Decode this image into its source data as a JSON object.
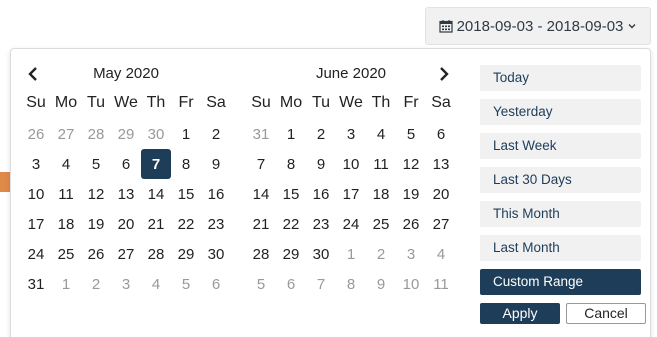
{
  "colors": {
    "accent": "#1e3d59",
    "muted_text": "#999999",
    "range_bg": "#f1f1f1",
    "side_tab": "#e08a4a"
  },
  "trigger": {
    "icon": "calendar-icon",
    "value": "2018-09-03 - 2018-09-03",
    "dropdown_icon": "chevron-down-icon"
  },
  "calendars": [
    {
      "month": "May 2020",
      "weekdays": [
        "Su",
        "Mo",
        "Tu",
        "We",
        "Th",
        "Fr",
        "Sa"
      ],
      "weeks": [
        [
          {
            "d": "26",
            "off": true
          },
          {
            "d": "27",
            "off": true
          },
          {
            "d": "28",
            "off": true
          },
          {
            "d": "29",
            "off": true
          },
          {
            "d": "30",
            "off": true
          },
          {
            "d": "1"
          },
          {
            "d": "2"
          }
        ],
        [
          {
            "d": "3"
          },
          {
            "d": "4"
          },
          {
            "d": "5"
          },
          {
            "d": "6"
          },
          {
            "d": "7",
            "active": true
          },
          {
            "d": "8"
          },
          {
            "d": "9"
          }
        ],
        [
          {
            "d": "10"
          },
          {
            "d": "11"
          },
          {
            "d": "12"
          },
          {
            "d": "13"
          },
          {
            "d": "14"
          },
          {
            "d": "15"
          },
          {
            "d": "16"
          }
        ],
        [
          {
            "d": "17"
          },
          {
            "d": "18"
          },
          {
            "d": "19"
          },
          {
            "d": "20"
          },
          {
            "d": "21"
          },
          {
            "d": "22"
          },
          {
            "d": "23"
          }
        ],
        [
          {
            "d": "24"
          },
          {
            "d": "25"
          },
          {
            "d": "26"
          },
          {
            "d": "27"
          },
          {
            "d": "28"
          },
          {
            "d": "29"
          },
          {
            "d": "30"
          }
        ],
        [
          {
            "d": "31"
          },
          {
            "d": "1",
            "off": true
          },
          {
            "d": "2",
            "off": true
          },
          {
            "d": "3",
            "off": true
          },
          {
            "d": "4",
            "off": true
          },
          {
            "d": "5",
            "off": true
          },
          {
            "d": "6",
            "off": true
          }
        ]
      ]
    },
    {
      "month": "June 2020",
      "weekdays": [
        "Su",
        "Mo",
        "Tu",
        "We",
        "Th",
        "Fr",
        "Sa"
      ],
      "weeks": [
        [
          {
            "d": "31",
            "off": true
          },
          {
            "d": "1"
          },
          {
            "d": "2"
          },
          {
            "d": "3"
          },
          {
            "d": "4"
          },
          {
            "d": "5"
          },
          {
            "d": "6"
          }
        ],
        [
          {
            "d": "7"
          },
          {
            "d": "8"
          },
          {
            "d": "9"
          },
          {
            "d": "10"
          },
          {
            "d": "11"
          },
          {
            "d": "12"
          },
          {
            "d": "13"
          }
        ],
        [
          {
            "d": "14"
          },
          {
            "d": "15"
          },
          {
            "d": "16"
          },
          {
            "d": "17"
          },
          {
            "d": "18"
          },
          {
            "d": "19"
          },
          {
            "d": "20"
          }
        ],
        [
          {
            "d": "21"
          },
          {
            "d": "22"
          },
          {
            "d": "23"
          },
          {
            "d": "24"
          },
          {
            "d": "25"
          },
          {
            "d": "26"
          },
          {
            "d": "27"
          }
        ],
        [
          {
            "d": "28"
          },
          {
            "d": "29"
          },
          {
            "d": "30"
          },
          {
            "d": "1",
            "off": true
          },
          {
            "d": "2",
            "off": true
          },
          {
            "d": "3",
            "off": true
          },
          {
            "d": "4",
            "off": true
          }
        ],
        [
          {
            "d": "5",
            "off": true
          },
          {
            "d": "6",
            "off": true
          },
          {
            "d": "7",
            "off": true
          },
          {
            "d": "8",
            "off": true
          },
          {
            "d": "9",
            "off": true
          },
          {
            "d": "10",
            "off": true
          },
          {
            "d": "11",
            "off": true
          }
        ]
      ]
    }
  ],
  "ranges": [
    {
      "label": "Today"
    },
    {
      "label": "Yesterday"
    },
    {
      "label": "Last Week"
    },
    {
      "label": "Last 30 Days"
    },
    {
      "label": "This Month"
    },
    {
      "label": "Last Month"
    },
    {
      "label": "Custom Range",
      "active": true
    }
  ],
  "buttons": {
    "apply": "Apply",
    "cancel": "Cancel"
  }
}
